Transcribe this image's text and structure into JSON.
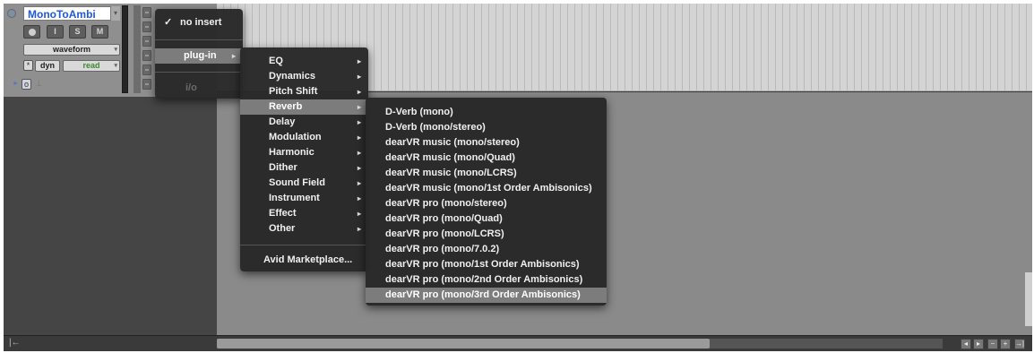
{
  "track": {
    "name": "MonoToAmbi",
    "buttons": {
      "record": "",
      "input": "I",
      "solo": "S",
      "mute": "M"
    },
    "view_selector": "waveform",
    "auto_star": "*",
    "dyn_label": "dyn",
    "automation_mode": "read"
  },
  "insert_menu": {
    "items": [
      {
        "label": "no insert",
        "checked": true
      },
      {
        "label": "plug-in",
        "highlighted": true
      },
      {
        "label": "i/o",
        "disabled": true
      }
    ],
    "check_glyph": "✓"
  },
  "plugin_menu": {
    "categories": [
      "EQ",
      "Dynamics",
      "Pitch Shift",
      "Reverb",
      "Delay",
      "Modulation",
      "Harmonic",
      "Dither",
      "Sound Field",
      "Instrument",
      "Effect",
      "Other"
    ],
    "highlighted": "Reverb",
    "marketplace": "Avid Marketplace..."
  },
  "reverb_menu": {
    "items": [
      "D-Verb (mono)",
      "D-Verb (mono/stereo)",
      "dearVR music (mono/stereo)",
      "dearVR music (mono/Quad)",
      "dearVR music (mono/LCRS)",
      "dearVR music (mono/1st Order Ambisonics)",
      "dearVR pro (mono/stereo)",
      "dearVR pro (mono/Quad)",
      "dearVR pro (mono/LCRS)",
      "dearVR pro (mono/7.0.2)",
      "dearVR pro (mono/1st Order Ambisonics)",
      "dearVR pro (mono/2nd Order Ambisonics)",
      "dearVR pro (mono/3rd Order Ambisonics)"
    ],
    "highlighted_index": 12
  },
  "bottom_bar": {
    "left_icon": "|←"
  },
  "icons": {
    "submenu_arrow": "▸",
    "dropdown_arrow": "▾",
    "close": "close-dot-icon",
    "nav": [
      "◂",
      "▸",
      "−",
      "+",
      "→|"
    ]
  },
  "colors": {
    "track_name": "#1f58d8",
    "automation_read": "#3b8a2e",
    "menu_bg": "#282828",
    "menu_highlight": "#7c7c7c"
  }
}
